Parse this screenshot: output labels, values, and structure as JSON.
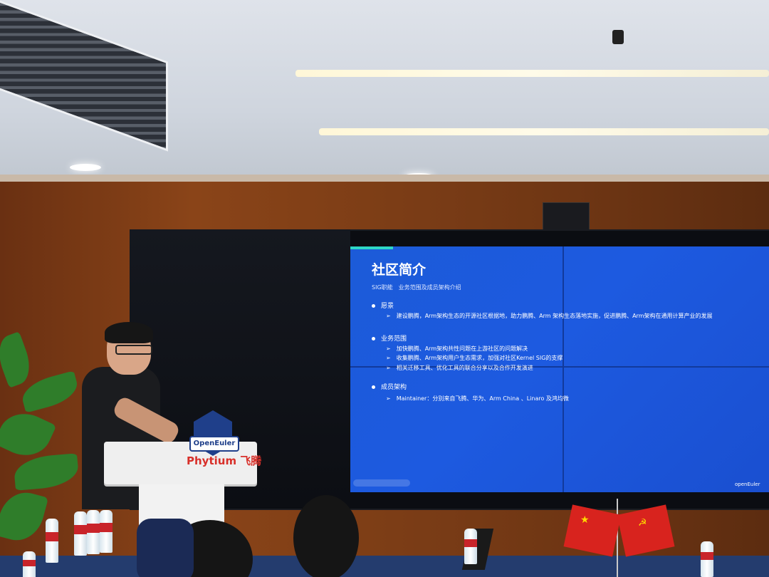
{
  "slide": {
    "title": "社区简介",
    "subtitle": "SIG职能　业务范围及成员架构介绍",
    "sections": [
      {
        "heading": "愿景",
        "items": [
          "建设鹏腾，Arm架构生态的开源社区根据地，助力鹏腾、Arm 架构生态落地实施，促进鹏腾、Arm架构在通用计算产业的发展"
        ]
      },
      {
        "heading": "业务范围",
        "items": [
          "加快鹏腾、Arm架构共性问题在上游社区的问题解决",
          "收集鹏腾、Arm架构用户生态需求，加强对社区Kernel SIG的支撑",
          "相关迁移工具、优化工具的联合分享以及合作开发演进"
        ]
      },
      {
        "heading": "成员架构",
        "items": [
          "Maintainer：分别来自飞腾、华为、Arm China 、Linaro 及鸿均微"
        ]
      }
    ],
    "footer_logos": [
      "openEuler"
    ]
  },
  "podium": {
    "badge_text": "OpenEuler",
    "brand_text": "Phytium 飞腾"
  },
  "colors": {
    "slide_blue": "#1c5bd8",
    "accent_teal": "#2ed7c6",
    "brand_red": "#d8302a",
    "badge_blue": "#1f3f8a"
  }
}
